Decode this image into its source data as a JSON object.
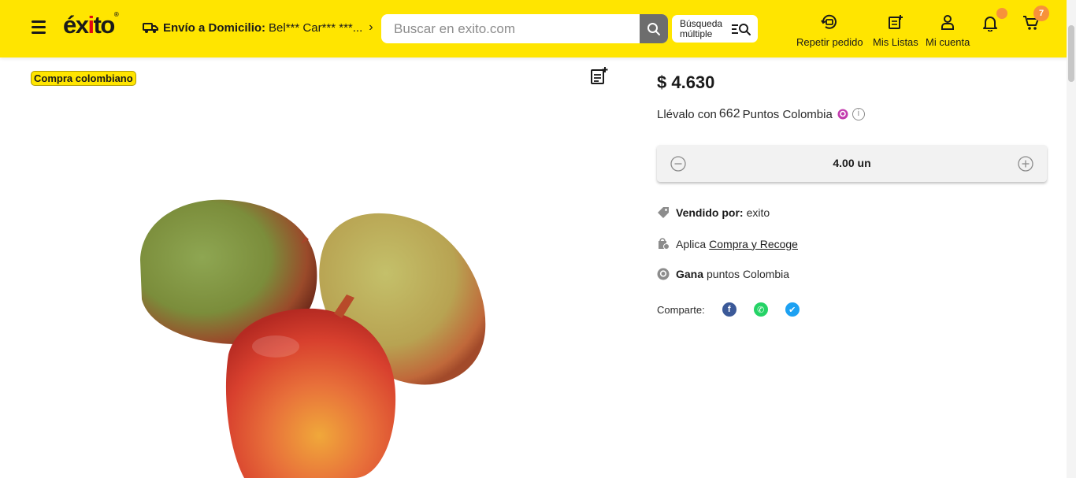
{
  "header": {
    "logo": "éxito",
    "delivery_label": "Envío a Domicilio:",
    "delivery_value": "Bel*** Car*** ***...",
    "search_placeholder": "Buscar en exito.com",
    "multi_search_label": "Búsqueda múltiple",
    "repeat_order_label": "Repetir pedido",
    "lists_label": "Mis Listas",
    "account_label": "Mi cuenta",
    "cart_count": "7"
  },
  "product": {
    "badge": "Compra colombiano",
    "price": "$ 4.630",
    "points_prefix": "Llévalo con",
    "points_value": "662",
    "points_suffix": "Puntos Colombia",
    "quantity": "4.00 un",
    "sold_by_label": "Vendido por:",
    "sold_by_value": "exito",
    "pickup_prefix": "Aplica",
    "pickup_link": "Compra y Recoge",
    "earn_label": "Gana",
    "earn_value": "puntos Colombia",
    "share_label": "Comparte:"
  },
  "colors": {
    "header_bg": "#ffe500",
    "accent_orange": "#f7923a",
    "facebook": "#3b5998",
    "whatsapp": "#25d366",
    "twitter": "#1da1f2"
  },
  "icons": [
    "menu-icon",
    "truck-icon",
    "chevron-right-icon",
    "search-icon",
    "multi-search-icon",
    "repeat-order-icon",
    "list-icon",
    "user-icon",
    "bell-icon",
    "cart-icon",
    "add-to-list-icon",
    "minus-icon",
    "plus-icon",
    "tag-icon",
    "store-pickup-icon",
    "puntos-icon",
    "info-icon",
    "facebook-icon",
    "whatsapp-icon",
    "twitter-icon"
  ]
}
